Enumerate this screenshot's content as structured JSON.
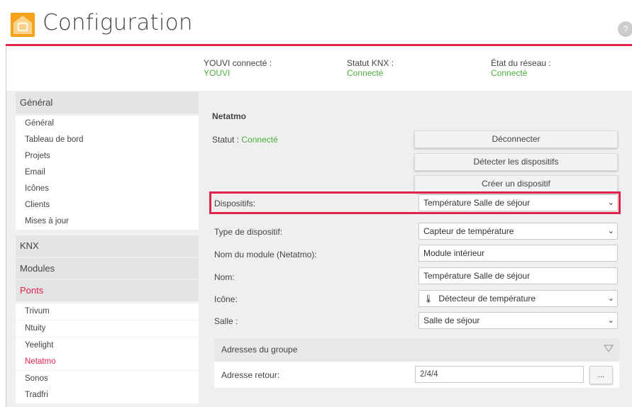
{
  "header": {
    "title": "Configuration",
    "help_icon": "?",
    "accent": "#e2224a"
  },
  "status": {
    "youvi_label": "YOUVI connecté :",
    "youvi_value": "YOUVI",
    "knx_label": "Statut KNX :",
    "knx_value": "Connecté",
    "network_label": "État du réseau :",
    "network_value": "Connecté",
    "ok_color": "#4caf3d"
  },
  "sidebar": {
    "general_title": "Général",
    "general_items": [
      "Général",
      "Tableau de bord",
      "Projets",
      "Email",
      "Icônes",
      "Clients",
      "Mises à jour"
    ],
    "knx_title": "KNX",
    "modules_title": "Modules",
    "ponts_title": "Ponts",
    "ponts_items": [
      "Trivum",
      "Ntuity",
      "Yeelight",
      "Netatmo",
      "Sonos",
      "Tradfri"
    ],
    "active_item": "Netatmo"
  },
  "main": {
    "section_title": "Netatmo",
    "statut_label": "Statut :",
    "statut_value": "Connecté",
    "buttons": {
      "disconnect": "Déconnecter",
      "detect": "Détecter les dispositifs",
      "create": "Créer un dispositif"
    },
    "fields": {
      "dispositifs_label": "Dispositifs:",
      "dispositifs_value": "Température Salle de séjour",
      "type_label": "Type de dispositif:",
      "type_value": "Capteur de température",
      "module_label": "Nom du module (Netatmo):",
      "module_value": "Module intérieur",
      "nom_label": "Nom:",
      "nom_value": "Température Salle de séjour",
      "icone_label": "Icône:",
      "icone_value": "Détecteur de température",
      "icone_icon": "temperature-sensor-icon",
      "salle_label": "Salle :",
      "salle_value": "Salle de séjour"
    },
    "group": {
      "title": "Adresses du groupe",
      "retour_label": "Adresse retour:",
      "retour_value": "2/4/4",
      "browse_label": "..."
    }
  }
}
